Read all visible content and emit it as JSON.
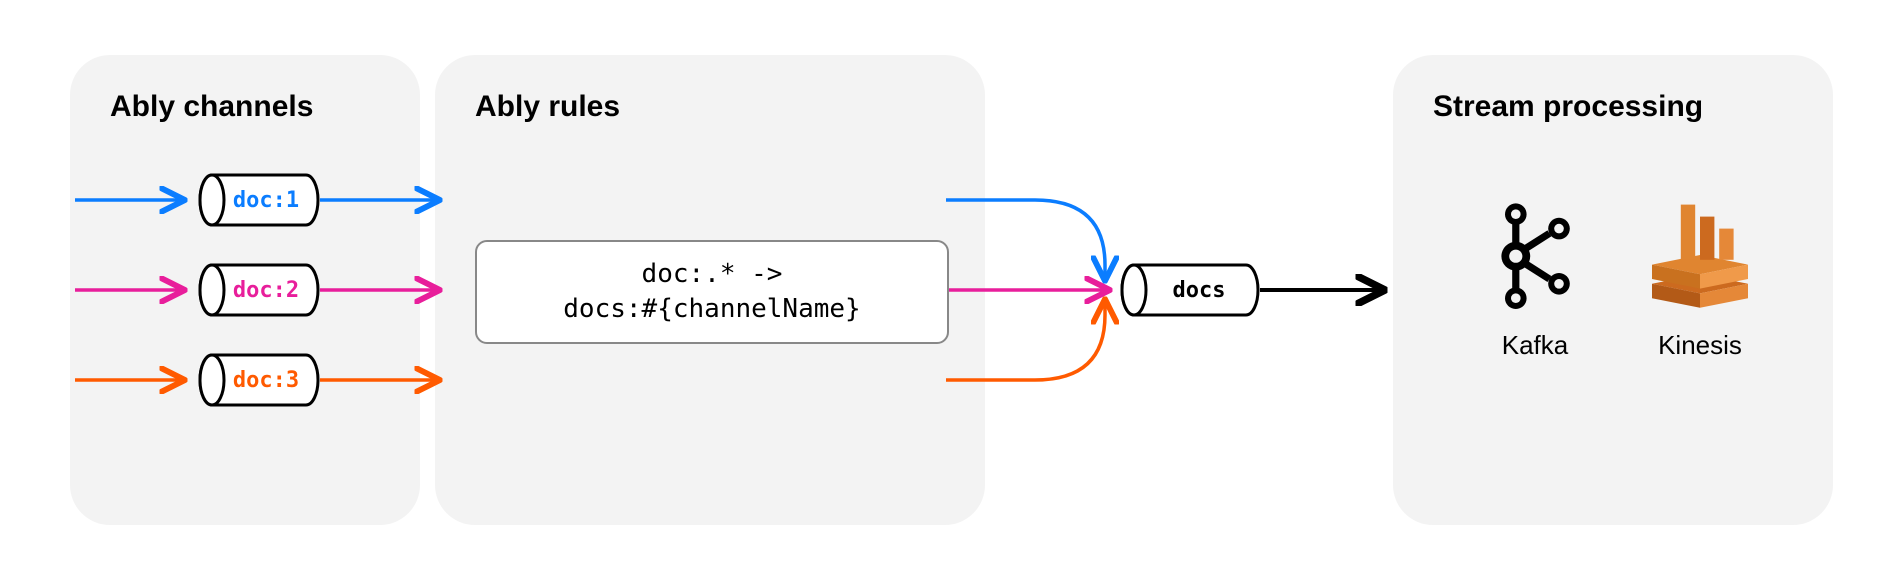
{
  "colors": {
    "blue": "#0B7DFF",
    "magenta": "#E81E9B",
    "orange": "#FF5A00",
    "kinesis": "#D97B28"
  },
  "channels": {
    "title": "Ably channels",
    "items": [
      {
        "label": "doc:1",
        "colorKey": "blue"
      },
      {
        "label": "doc:2",
        "colorKey": "magenta"
      },
      {
        "label": "doc:3",
        "colorKey": "orange"
      }
    ]
  },
  "rules": {
    "title": "Ably rules",
    "line1": "doc:.* ->",
    "line2": "docs:#{channelName}"
  },
  "dest": {
    "label": "docs"
  },
  "stream": {
    "title": "Stream processing",
    "services": [
      {
        "name": "Kafka"
      },
      {
        "name": "Kinesis"
      }
    ]
  }
}
